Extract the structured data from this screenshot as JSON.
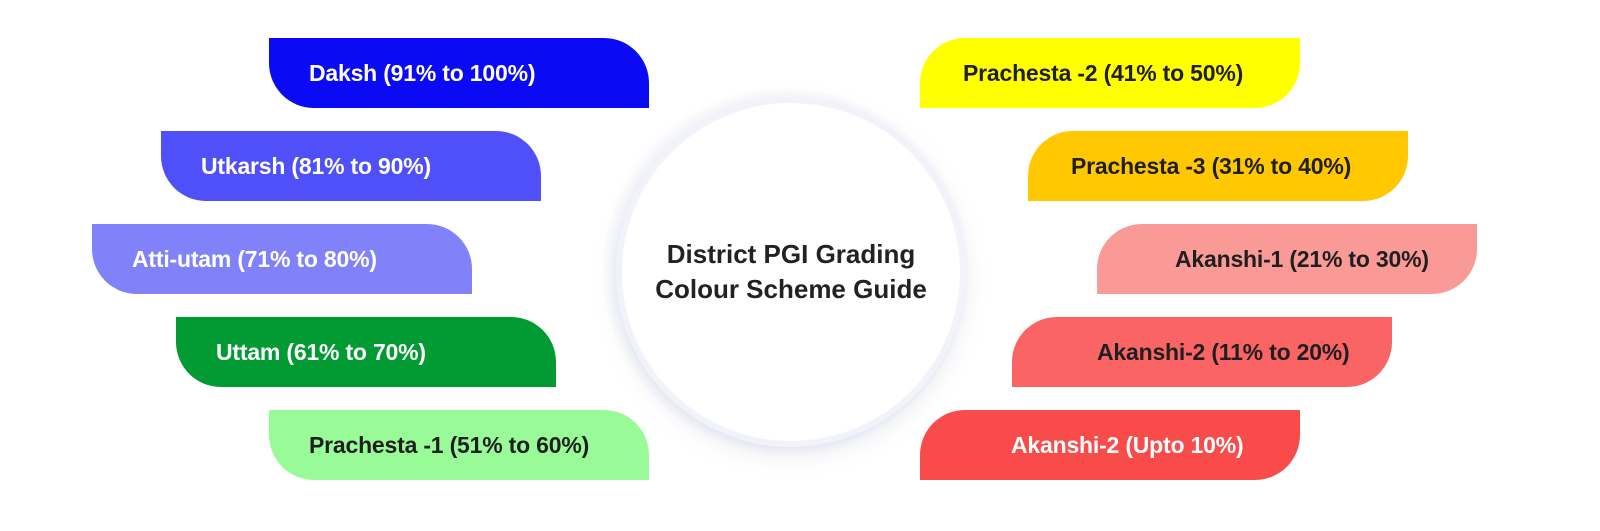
{
  "center": {
    "line1": "District PGI Grading",
    "line2": "Colour Scheme Guide"
  },
  "grades_left": [
    {
      "label": "Daksh (91% to 100%)",
      "color": "#0a0af5",
      "text_color": "#ffffff"
    },
    {
      "label": "Utkarsh (81% to 90%)",
      "color": "#5050fb",
      "text_color": "#ffffff"
    },
    {
      "label": "Atti-utam (71% to 80%)",
      "color": "#8181fa",
      "text_color": "#ffffff"
    },
    {
      "label": "Uttam (61% to 70%)",
      "color": "#029a32",
      "text_color": "#ffffff"
    },
    {
      "label": "Prachesta -1 (51% to 60%)",
      "color": "#98fb98",
      "text_color": "#1f1f1f"
    }
  ],
  "grades_right": [
    {
      "label": "Prachesta -2 (41% to 50%)",
      "color": "#ffff00",
      "text_color": "#1f1f1f"
    },
    {
      "label": "Prachesta -3 (31% to 40%)",
      "color": "#ffc800",
      "text_color": "#1f1f1f"
    },
    {
      "label": "Akanshi-1 (21% to 30%)",
      "color": "#fa9a96",
      "text_color": "#1f1f1f"
    },
    {
      "label": "Akanshi-2 (11% to 20%)",
      "color": "#fa6464",
      "text_color": "#1f1f1f"
    },
    {
      "label": "Akanshi-2 (Upto 10%)",
      "color": "#fa4b4b",
      "text_color": "#ffffff"
    }
  ]
}
